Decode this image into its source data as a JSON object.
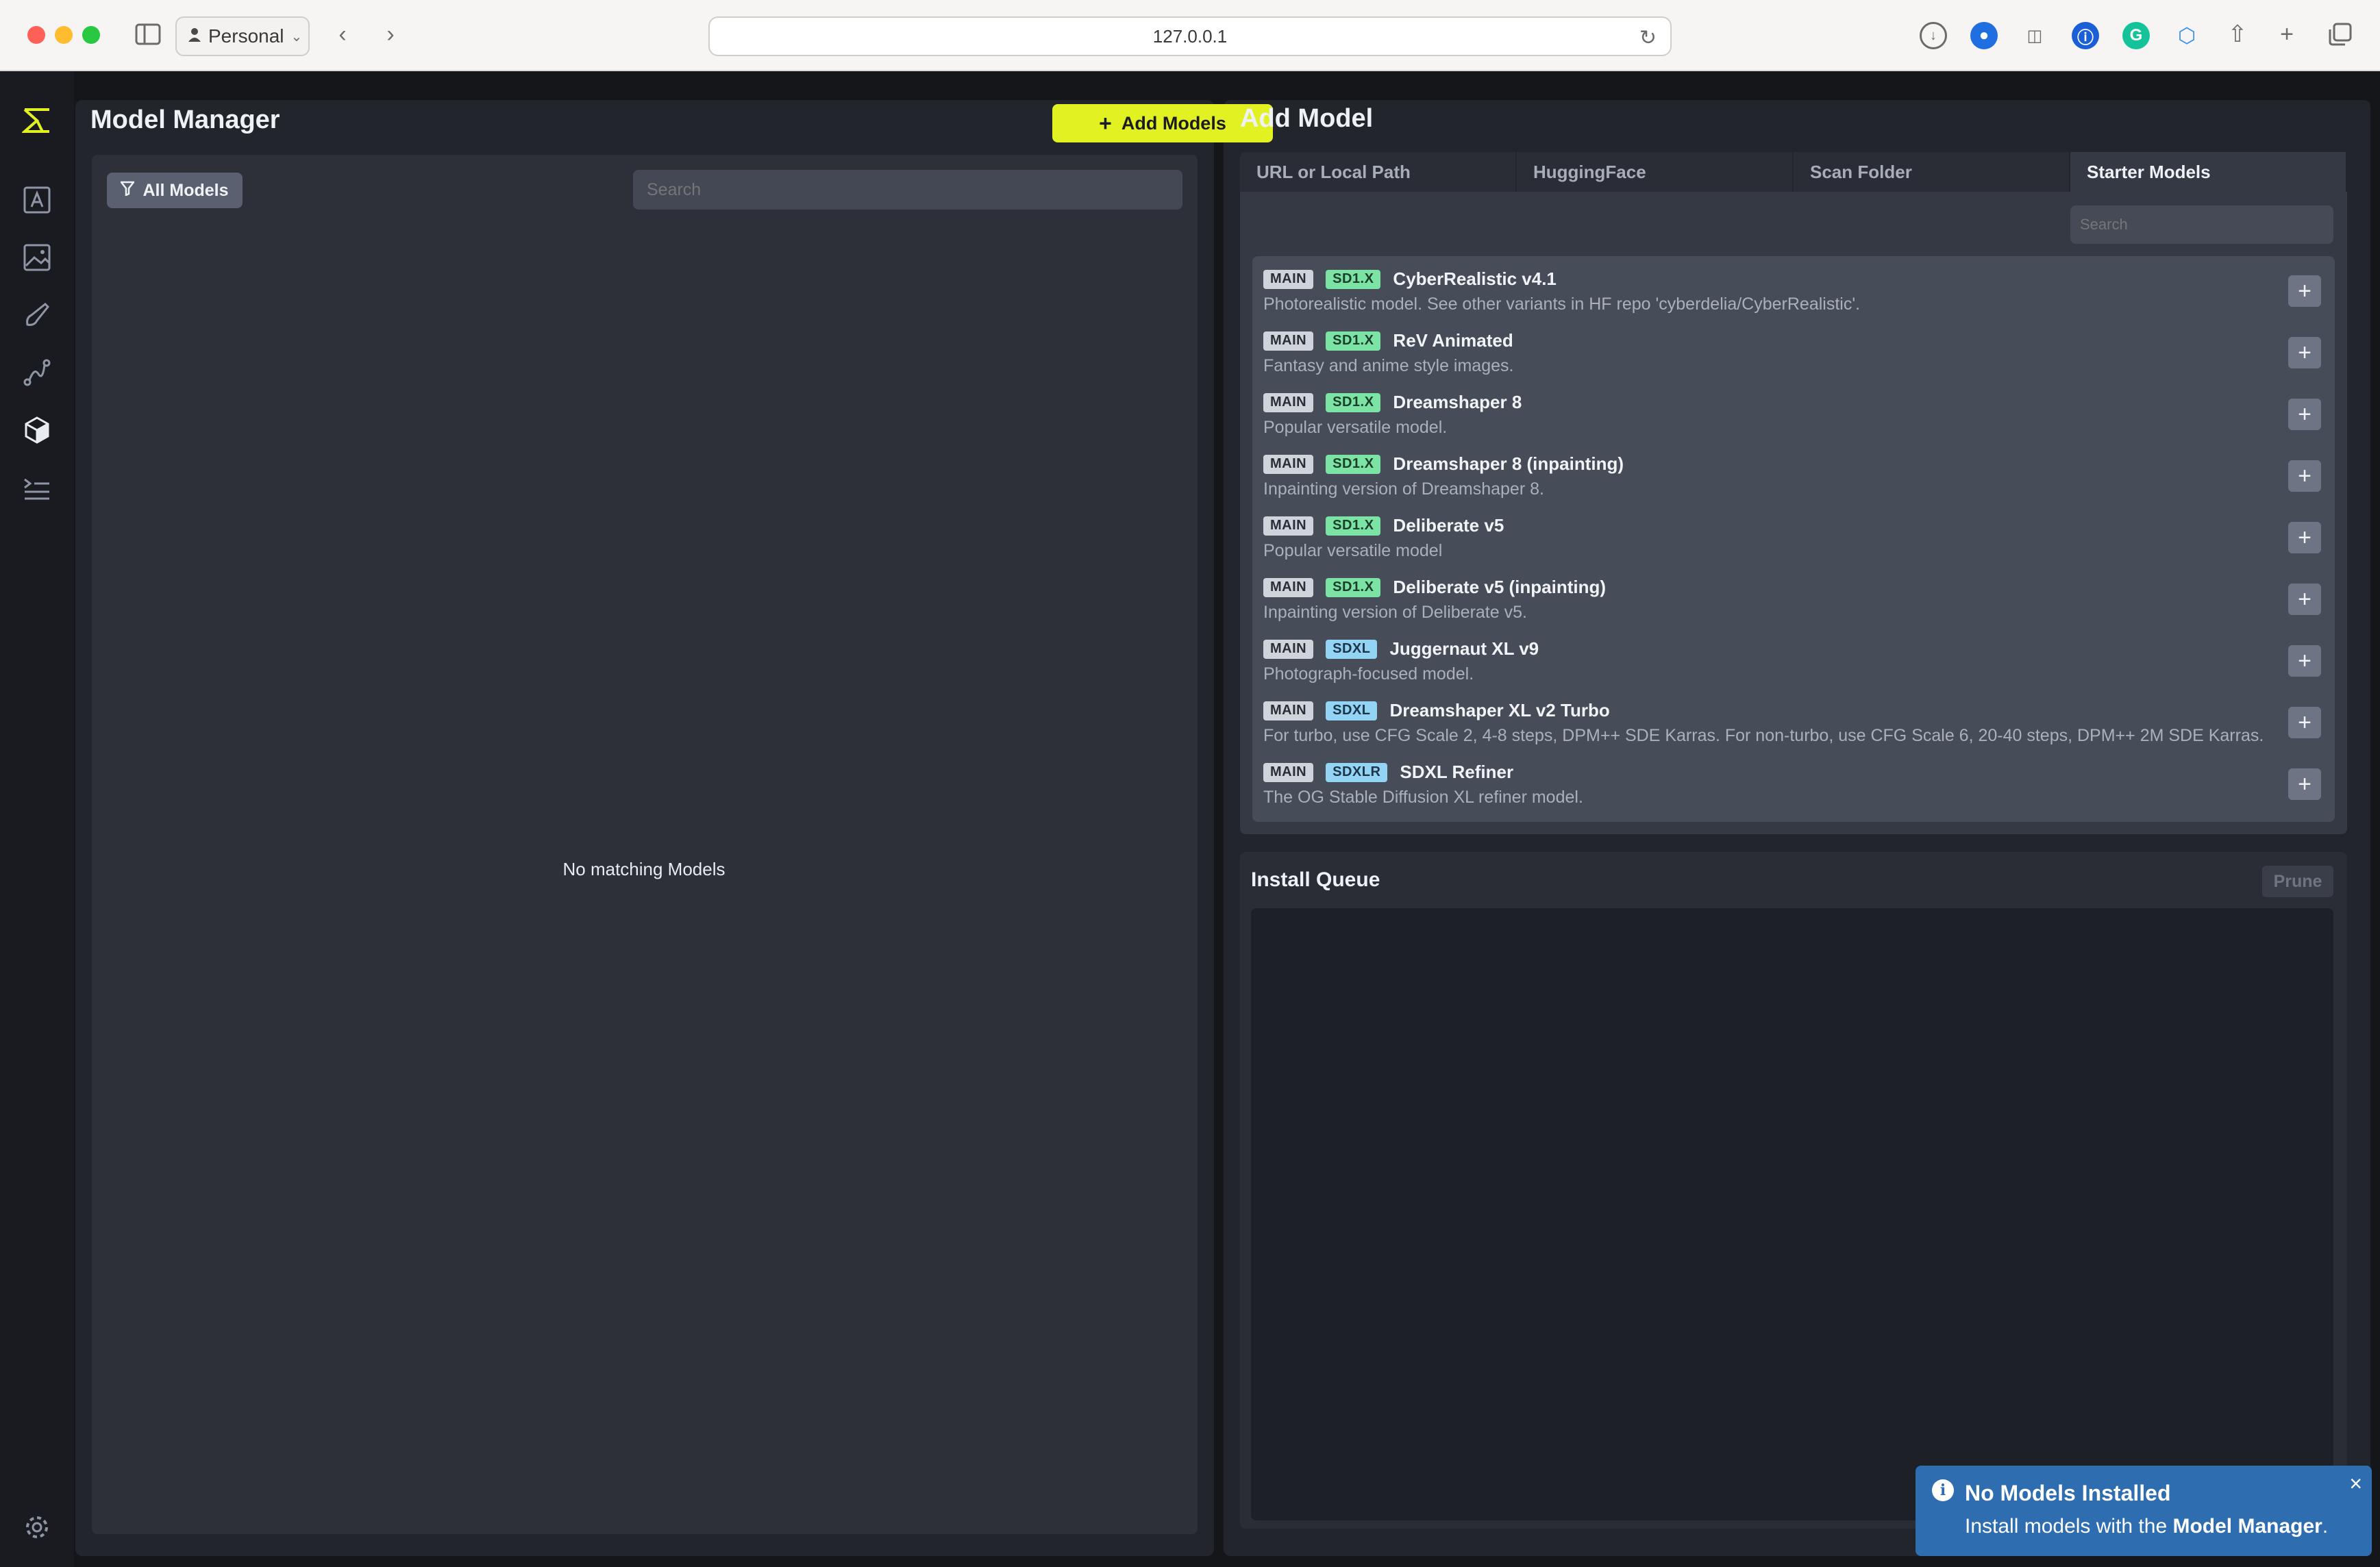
{
  "browser": {
    "profile": "Personal",
    "url": "127.0.0.1"
  },
  "model_manager": {
    "title": "Model Manager",
    "add_models_label": "Add Models",
    "filter_label": "All Models",
    "search_placeholder": "Search",
    "empty_message": "No matching Models"
  },
  "add_model": {
    "title": "Add Model",
    "tabs": [
      {
        "label": "URL or Local Path"
      },
      {
        "label": "HuggingFace"
      },
      {
        "label": "Scan Folder"
      },
      {
        "label": "Starter Models"
      }
    ],
    "search_placeholder": "Search",
    "starter_models": [
      {
        "type": "MAIN",
        "base": "SD1.X",
        "name": "CyberRealistic v4.1",
        "description": "Photorealistic model. See other variants in HF repo 'cyberdelia/CyberRealistic'."
      },
      {
        "type": "MAIN",
        "base": "SD1.X",
        "name": "ReV Animated",
        "description": "Fantasy and anime style images."
      },
      {
        "type": "MAIN",
        "base": "SD1.X",
        "name": "Dreamshaper 8",
        "description": "Popular versatile model."
      },
      {
        "type": "MAIN",
        "base": "SD1.X",
        "name": "Dreamshaper 8 (inpainting)",
        "description": "Inpainting version of Dreamshaper 8."
      },
      {
        "type": "MAIN",
        "base": "SD1.X",
        "name": "Deliberate v5",
        "description": "Popular versatile model"
      },
      {
        "type": "MAIN",
        "base": "SD1.X",
        "name": "Deliberate v5 (inpainting)",
        "description": "Inpainting version of Deliberate v5."
      },
      {
        "type": "MAIN",
        "base": "SDXL",
        "name": "Juggernaut XL v9",
        "description": "Photograph-focused model."
      },
      {
        "type": "MAIN",
        "base": "SDXL",
        "name": "Dreamshaper XL v2 Turbo",
        "description": "For turbo, use CFG Scale 2, 4-8 steps, DPM++ SDE Karras. For non-turbo, use CFG Scale 6, 20-40 steps, DPM++ 2M SDE Karras."
      },
      {
        "type": "MAIN",
        "base": "SDXLR",
        "name": "SDXL Refiner",
        "description": "The OG Stable Diffusion XL refiner model."
      }
    ]
  },
  "install_queue": {
    "title": "Install Queue",
    "prune_label": "Prune"
  },
  "toast": {
    "title": "No Models Installed",
    "message_prefix": "Install models with the ",
    "message_link": "Model Manager",
    "message_suffix": "."
  },
  "colors": {
    "accent": "#e1f121",
    "toast": "#2e6db0",
    "badge_sd1": "#7be3a3",
    "badge_sdxl": "#93d4f5"
  }
}
